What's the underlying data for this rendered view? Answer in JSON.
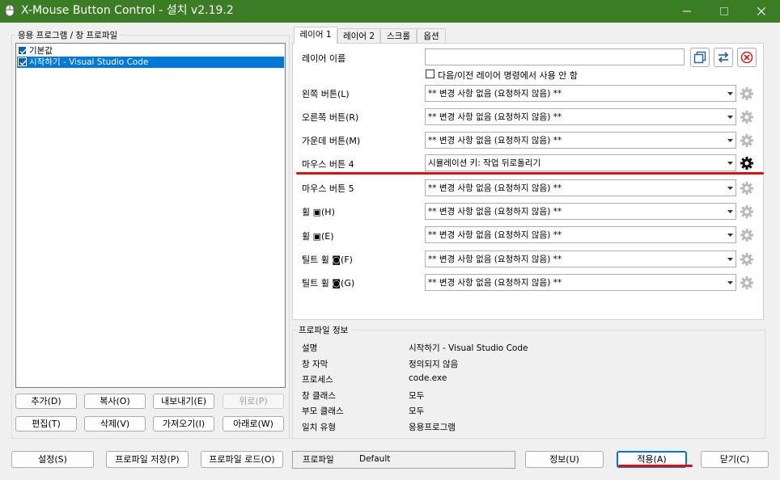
{
  "window": {
    "title": "X-Mouse Button Control - 설치 v2.19.2"
  },
  "apps_group": {
    "label": "응용 프로그램 / 창 프로파일",
    "items": [
      {
        "label": "기본값"
      },
      {
        "label": "시작하기 - Visual Studio Code"
      }
    ],
    "buttons": {
      "add": "추가(D)",
      "copy": "복사(O)",
      "export": "내보내기(E)",
      "up": "위로(P)",
      "edit": "편집(T)",
      "delete": "삭제(V)",
      "import": "가져오기(I)",
      "down": "아래로(W)"
    }
  },
  "tabs": [
    "레이어 1",
    "레이어 2",
    "스크롤",
    "옵션"
  ],
  "layer": {
    "name_label": "레이어 이름",
    "name_value": "",
    "disable_nav_label": "다음/이전 레이어 명령에서 사용 안 함",
    "rows": [
      {
        "label": "왼쪽 버튼(L)",
        "value": "** 변경 사항 없음 (요청하지 않음) **"
      },
      {
        "label": "오른쪽 버튼(R)",
        "value": "** 변경 사항 없음 (요청하지 않음) **"
      },
      {
        "label": "가운데 버튼(M)",
        "value": "** 변경 사항 없음 (요청하지 않음) **"
      },
      {
        "label": "마우스 버튼 4",
        "value": "시뮬레이션 키: 작업 뒤로돌리기"
      },
      {
        "label": "마우스 버튼 5",
        "value": "** 변경 사항 없음 (요청하지 않음) **"
      },
      {
        "label": "휠 ▣(H)",
        "value": "** 변경 사항 없음 (요청하지 않음) **"
      },
      {
        "label": "휠 ▣(E)",
        "value": "** 변경 사항 없음 (요청하지 않음) **"
      },
      {
        "label": "틸트 휠 ◙(F)",
        "value": "** 변경 사항 없음 (요청하지 않음) **"
      },
      {
        "label": "틸트 휠 ◙(G)",
        "value": "** 변경 사항 없음 (요청하지 않음) **"
      }
    ]
  },
  "profile_info": {
    "label": "프로파일 정보",
    "rows": [
      {
        "label": "설명",
        "value": "시작하기 - Visual Studio Code"
      },
      {
        "label": "창 자막",
        "value": "정의되지 않음"
      },
      {
        "label": "프로세스",
        "value": "code.exe"
      },
      {
        "label": "창 클래스",
        "value": "모두"
      },
      {
        "label": "부모 클래스",
        "value": "모두"
      },
      {
        "label": "일치 유형",
        "value": "응용프로그램"
      }
    ]
  },
  "bottom": {
    "settings": "설정(S)",
    "save_profile": "프로파일 저장(P)",
    "load_profile": "프로파일 로드(O)",
    "profile_label": "프로파일",
    "profile_value": "Default",
    "about": "정보(U)",
    "apply": "적용(A)",
    "close": "닫기(C)"
  },
  "colors": {
    "titlebar": "#3a7d24",
    "accent": "#0078d7",
    "highlight": "#e01010"
  }
}
